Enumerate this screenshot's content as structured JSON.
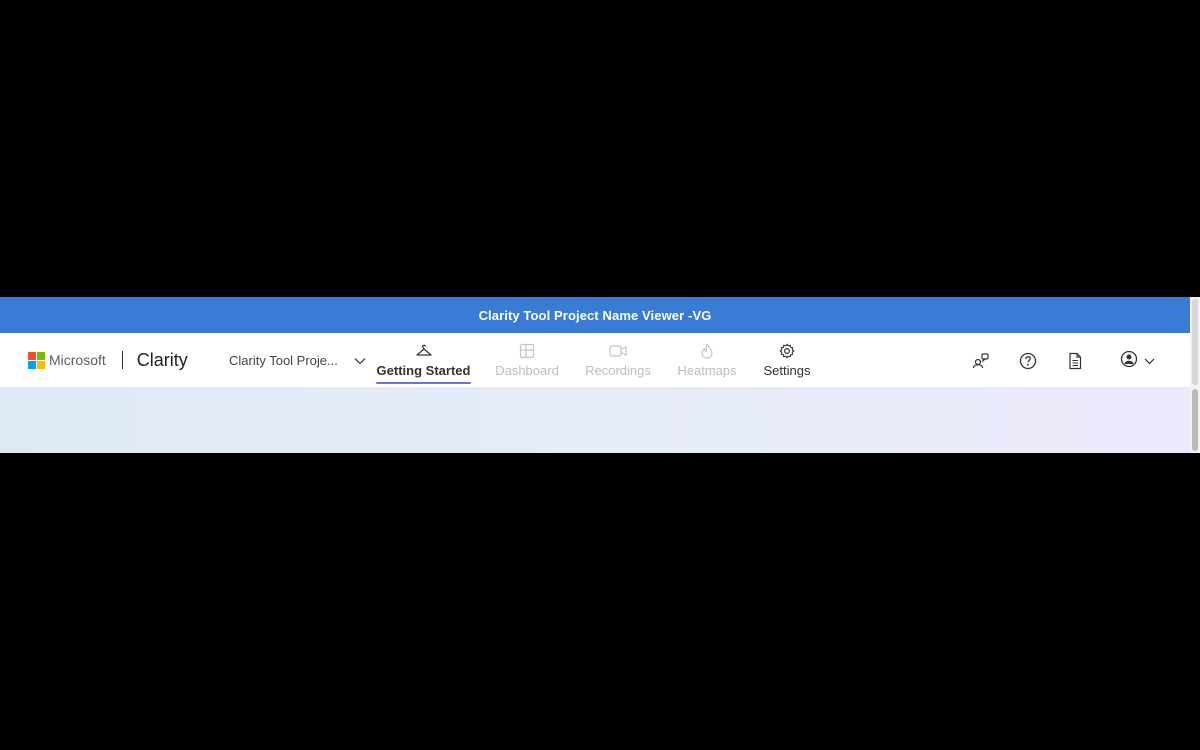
{
  "banner": {
    "title": "Clarity Tool Project Name Viewer -VG"
  },
  "brand": {
    "company": "Microsoft",
    "product": "Clarity"
  },
  "project_selector": {
    "value": "Clarity Tool Proje..."
  },
  "nav": [
    {
      "label": "Getting Started",
      "icon": "hanger-icon",
      "state": "active"
    },
    {
      "label": "Dashboard",
      "icon": "dashboard-icon",
      "state": "disabled"
    },
    {
      "label": "Recordings",
      "icon": "video-icon",
      "state": "disabled"
    },
    {
      "label": "Heatmaps",
      "icon": "flame-icon",
      "state": "disabled"
    },
    {
      "label": "Settings",
      "icon": "gear-icon",
      "state": "normal"
    }
  ],
  "right_icons": [
    "share-people-icon",
    "help-icon",
    "document-icon",
    "account-icon"
  ],
  "colors": {
    "banner": "#3a7bd5",
    "active_underline": "#6d72e0",
    "disabled_text": "#bdbdbd",
    "ms_red": "#f25022",
    "ms_green": "#7fba00",
    "ms_blue": "#00a4ef",
    "ms_yellow": "#ffb900"
  }
}
